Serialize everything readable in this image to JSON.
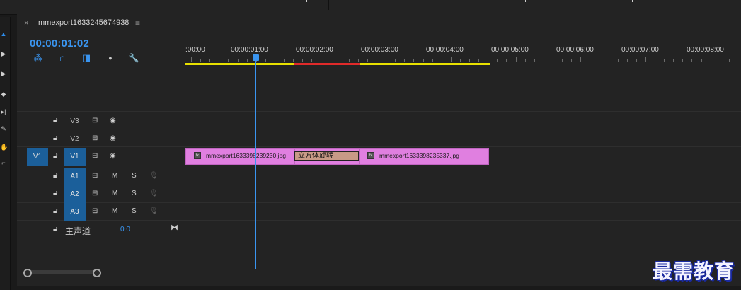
{
  "sequence": {
    "tab_title": "mmexport1633245674938",
    "close_glyph": "×",
    "menu_glyph": "≡",
    "timecode": "00:00:01:02"
  },
  "header_tools": [
    {
      "name": "snap-icon",
      "glyph": "⁂"
    },
    {
      "name": "linked-selection-icon",
      "glyph": "∩"
    },
    {
      "name": "add-marker-icon",
      "glyph": "◨"
    },
    {
      "name": "marker-icon",
      "glyph": "●"
    },
    {
      "name": "wrench-icon",
      "glyph": "🔧"
    }
  ],
  "ruler": {
    "labels": [
      ":00:00",
      "00:00:01:00",
      "00:00:02:00",
      "00:00:03:00",
      "00:00:04:00",
      "00:00:05:00",
      "00:00:06:00",
      "00:00:07:00",
      "00:00:08:00"
    ],
    "work_colors": {
      "yellow": "#e8e000",
      "red": "#e02a2a"
    }
  },
  "video_tracks": [
    {
      "target": "V3",
      "source": ""
    },
    {
      "target": "V2",
      "source": ""
    },
    {
      "target": "V1",
      "source": "V1"
    }
  ],
  "audio_tracks": [
    {
      "target": "A1",
      "mute": "M",
      "solo": "S"
    },
    {
      "target": "A2",
      "mute": "M",
      "solo": "S"
    },
    {
      "target": "A3",
      "mute": "M",
      "solo": "S"
    }
  ],
  "master": {
    "label": "主声道",
    "value": "0.0"
  },
  "clips": [
    {
      "name": "mmexport1633398239230.jpg",
      "fx": "fx"
    },
    {
      "name": "mmexport1633398235337.jpg",
      "fx": "fx"
    }
  ],
  "transition": {
    "label": "立方体旋转"
  },
  "watermark": "最需教育",
  "colors": {
    "accent": "#3a95f0",
    "clip": "#e07fe0",
    "track_target": "#1b5f9a"
  }
}
